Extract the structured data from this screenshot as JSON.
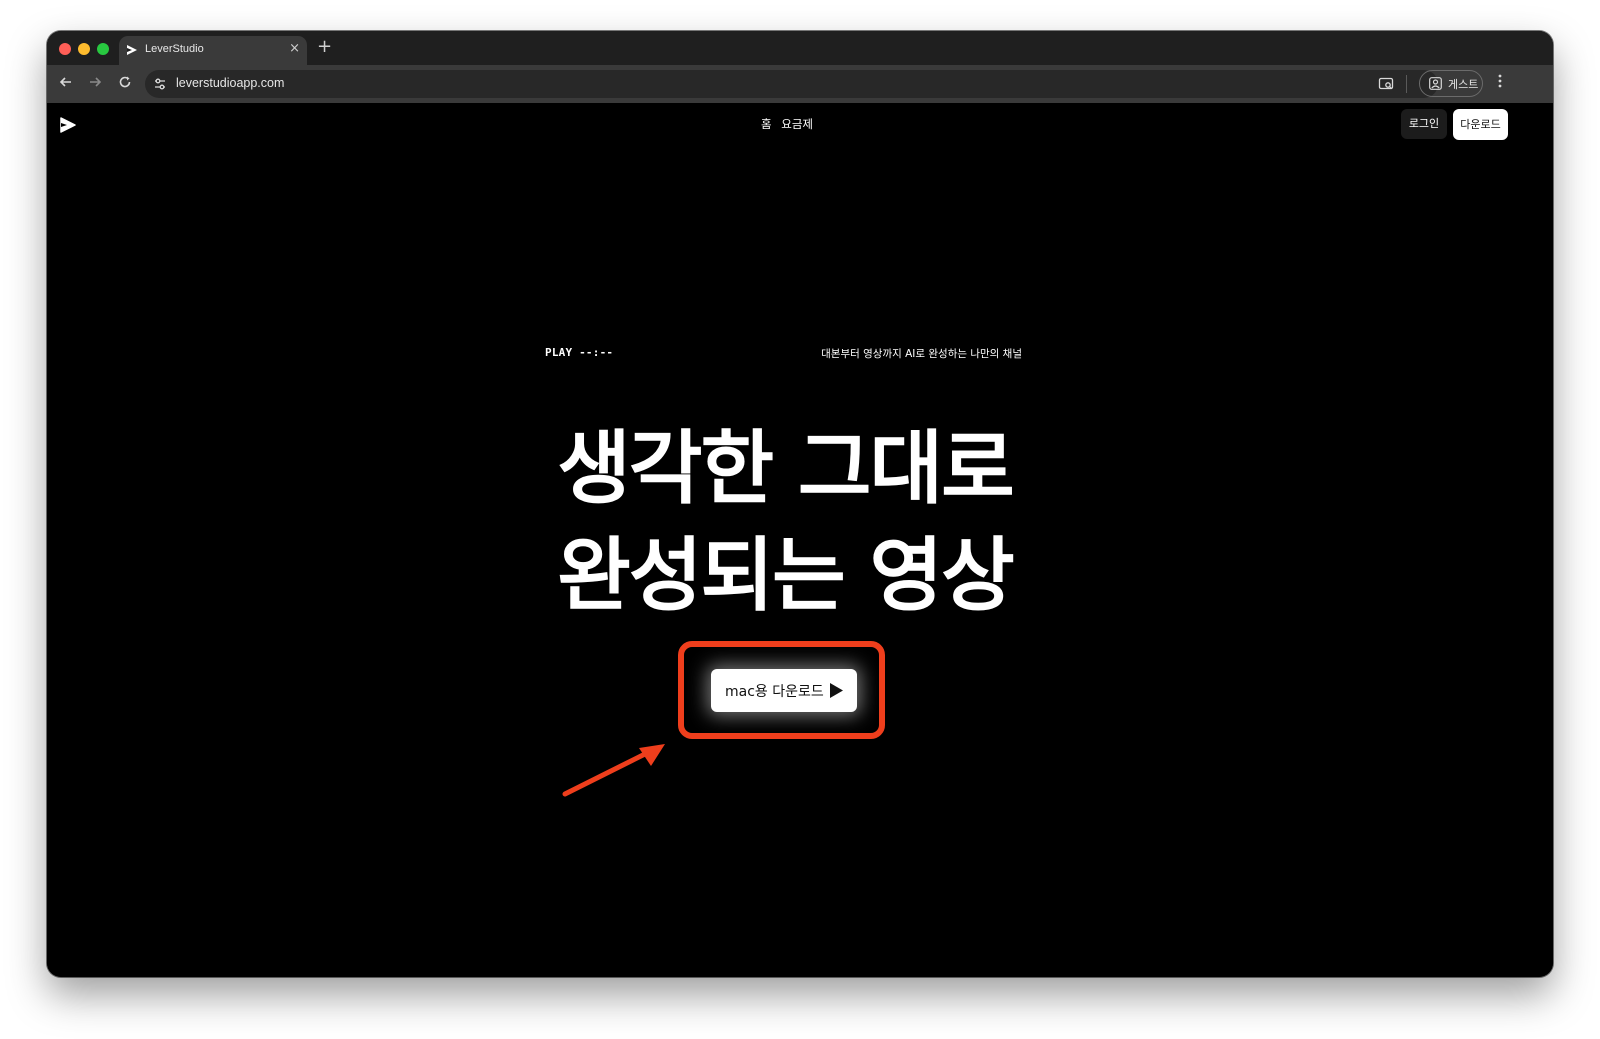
{
  "browser": {
    "tab_title": "LeverStudio",
    "tab_close": "×",
    "new_tab": "+",
    "url": "leverstudioapp.com",
    "profile_label": "게스트",
    "icons": [
      "back-arrow-icon",
      "forward-arrow-icon",
      "reload-icon",
      "site-settings-icon",
      "cast-icon",
      "profile-icon",
      "kebab-menu-icon"
    ]
  },
  "site": {
    "nav": {
      "home": "홈",
      "pricing": "요금제"
    },
    "login_label": "로그인",
    "download_label": "다운로드",
    "play_readout": "PLAY --:--",
    "tagline": "대본부터 영상까지 AI로 완성하는 나만의 채널",
    "hero_line1": "생각한 그대로",
    "hero_line2": "완성되는 영상",
    "cta_label": "mac용 다운로드",
    "accent_color": "#ef3e1c"
  }
}
